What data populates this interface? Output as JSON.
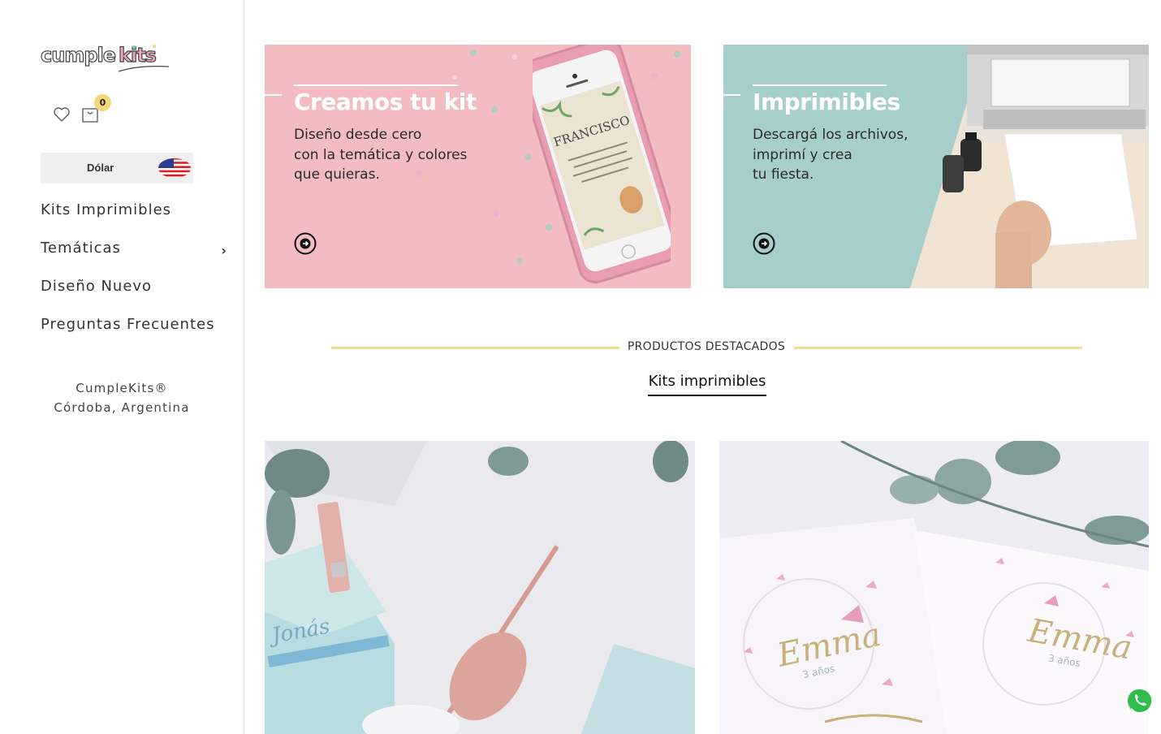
{
  "sidebar": {
    "logo_text": "cumplekits",
    "cart_count": "0",
    "currency_label": "Dólar",
    "nav": [
      {
        "label": "Kits Imprimibles"
      },
      {
        "label": "Temáticas",
        "arrow": "›"
      },
      {
        "label": "Diseño Nuevo"
      },
      {
        "label": "Preguntas Frecuentes"
      }
    ],
    "footer_line1": "CumpleKits®",
    "footer_line2": "Córdoba, Argentina"
  },
  "banners": [
    {
      "title": "Creamos tu kit",
      "lines": [
        "Diseño desde cero",
        "con la temática y colores",
        "que quieras."
      ],
      "bg": "#f2bcc1"
    },
    {
      "title": "Imprimibles",
      "lines": [
        "Descargá los archivos,",
        "imprimí y crea",
        "tu fiesta."
      ],
      "bg": "#a6cfcb"
    }
  ],
  "phone_card": {
    "line1": "FRANCISCO"
  },
  "section": {
    "title": "PRODUCTOS DESTACADOS",
    "active_tab": "Kits imprimibles"
  },
  "products": [
    {
      "label": "Jonás"
    },
    {
      "label": "Emma",
      "sub": "3 años"
    }
  ],
  "icons": {
    "wishlist": "heart-icon",
    "cart": "shopping-bag-icon",
    "currency_flag": "us-flag-icon",
    "banner_link": "arrow-circle-icon",
    "whatsapp": "whatsapp-icon"
  }
}
